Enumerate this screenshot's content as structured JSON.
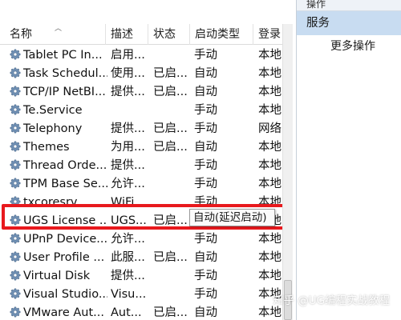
{
  "columns": {
    "name": "名称",
    "description": "描述",
    "status": "状态",
    "startup_type": "启动类型",
    "logon_as": "登录"
  },
  "services": [
    {
      "name": "Tablet PC In...",
      "description": "启用...",
      "status": "",
      "startup_type": "手动",
      "logon_as": "本地"
    },
    {
      "name": "Task Schedul...",
      "description": "使用...",
      "status": "已启...",
      "startup_type": "自动",
      "logon_as": "本地"
    },
    {
      "name": "TCP/IP NetBI...",
      "description": "提供...",
      "status": "已启...",
      "startup_type": "自动",
      "logon_as": "本地"
    },
    {
      "name": "Te.Service",
      "description": "",
      "status": "",
      "startup_type": "手动",
      "logon_as": "本地"
    },
    {
      "name": "Telephony",
      "description": "提供...",
      "status": "已启...",
      "startup_type": "手动",
      "logon_as": "网络"
    },
    {
      "name": "Themes",
      "description": "为用...",
      "status": "已启...",
      "startup_type": "自动",
      "logon_as": "本地"
    },
    {
      "name": "Thread Orde...",
      "description": "提供...",
      "status": "",
      "startup_type": "手动",
      "logon_as": "本地"
    },
    {
      "name": "TPM Base Se...",
      "description": "允许...",
      "status": "",
      "startup_type": "手动",
      "logon_as": "本地"
    },
    {
      "name": "txcoresrv",
      "description": "WiFi...",
      "status": "",
      "startup_type": "手动",
      "logon_as": "本地"
    },
    {
      "name": "UGS License ...",
      "description": "UGS...",
      "status": "已启...",
      "startup_type": "",
      "logon_as": "本地"
    },
    {
      "name": "UPnP Device...",
      "description": "允许...",
      "status": "",
      "startup_type": "手动",
      "logon_as": "本地"
    },
    {
      "name": "User Profile ...",
      "description": "此服...",
      "status": "已启...",
      "startup_type": "自动",
      "logon_as": "本地"
    },
    {
      "name": "Virtual Disk",
      "description": "提供...",
      "status": "",
      "startup_type": "手动",
      "logon_as": "本地"
    },
    {
      "name": "Visual Studio...",
      "description": "Visu...",
      "status": "",
      "startup_type": "手动",
      "logon_as": "本地"
    },
    {
      "name": "VMware Aut...",
      "description": "Aut...",
      "status": "已启...",
      "startup_type": "自动",
      "logon_as": "本地"
    }
  ],
  "highlighted_row_tooltip": "自动(延迟启动)",
  "actions": {
    "title": "操作",
    "section": "服务",
    "more_actions": "更多操作"
  },
  "watermark": "知乎 @UG编程实战教程",
  "colors": {
    "highlight_border": "#e8191d",
    "actions_section_bg": "#c8dcf1",
    "gear_icon": "#5b7fa6"
  },
  "icons": {
    "service": "gear-icon"
  }
}
